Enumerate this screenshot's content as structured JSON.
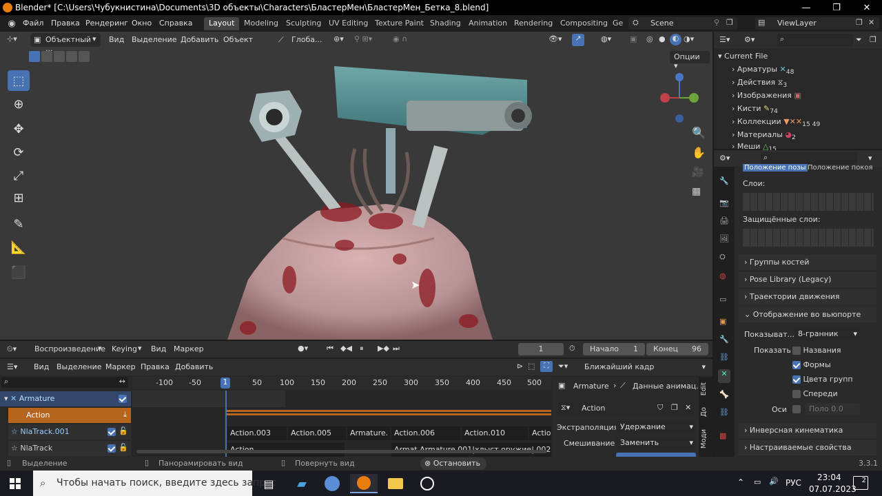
{
  "title": "Blender* [C:\\Users\\Чубукнистина\\Documents\\3D объекты\\Characters\\БластерМен\\БластерМен_Бетка_8.blend]",
  "menu": [
    "Файл",
    "Правка",
    "Рендеринг",
    "Окно",
    "Справка"
  ],
  "workspaces": [
    "Layout",
    "Modeling",
    "Sculpting",
    "UV Editing",
    "Texture Paint",
    "Shading",
    "Animation",
    "Rendering",
    "Compositing",
    "Ge"
  ],
  "scene": "Scene",
  "view_layer": "ViewLayer",
  "viewport": {
    "mode": "Объектный ...",
    "menus": [
      "Вид",
      "Выделение",
      "Добавить",
      "Объект"
    ],
    "transform": "Глоба...",
    "options": "Опции"
  },
  "outliner": {
    "root": "Current File",
    "items": [
      {
        "label": "Арматуры",
        "count": "48"
      },
      {
        "label": "Действия",
        "count": "3"
      },
      {
        "label": "Изображения",
        "count": ""
      },
      {
        "label": "Кисти",
        "count": "74"
      },
      {
        "label": "Коллекции",
        "count": "15 49"
      },
      {
        "label": "Материалы",
        "count": "2"
      },
      {
        "label": "Меши",
        "count": "15"
      }
    ]
  },
  "properties": {
    "tab1": "Положение позы",
    "tab2": "Положение покоя",
    "layers_label": "Слои:",
    "protected_label": "Защищённые слои:",
    "sections": [
      "Группы костей",
      "Pose Library (Legacy)",
      "Траектории движения",
      "Отображение во вьюпорте"
    ],
    "display_as_label": "Показыват...",
    "display_as_value": "8-гранник",
    "show_label": "Показать",
    "checks": [
      {
        "label": "Названия",
        "on": false
      },
      {
        "label": "Формы",
        "on": true
      },
      {
        "label": "Цвета групп",
        "on": true
      },
      {
        "label": "Спереди",
        "on": false
      }
    ],
    "axes_label": "Оси",
    "axes_field": "Поло",
    "axes_value": "0.0",
    "sections2": [
      "Инверсная кинематика",
      "Настраиваемые свойства"
    ]
  },
  "timeline": {
    "playback": "Воспроизведение",
    "keying": "Keying",
    "view": "Вид",
    "marker": "Маркер",
    "current_frame": "1",
    "start_label": "Начало",
    "start": "1",
    "end_label": "Конец",
    "end": "96"
  },
  "nla": {
    "menus": [
      "Вид",
      "Выделение",
      "Маркер",
      "Правка",
      "Добавить"
    ],
    "snap": "Ближайший кадр",
    "ruler": [
      "-100",
      "-50",
      "1",
      "50",
      "100",
      "150",
      "200",
      "250",
      "300",
      "350",
      "400",
      "450",
      "500"
    ],
    "tracks": [
      {
        "name": "Armature",
        "type": "object"
      },
      {
        "name": "Action",
        "type": "action"
      },
      {
        "name": "NlaTrack.001",
        "type": "track"
      },
      {
        "name": "NlaTrack",
        "type": "track"
      }
    ],
    "strips_row1": [
      "Action.003",
      "Action.005",
      "Armature.",
      "Action.006",
      "Action.010",
      "Actio"
    ],
    "strips_row2": [
      "Action",
      "Armat",
      "Armature.001|хлыст.оружие|.002"
    ],
    "side": {
      "breadcrumb1": "Armature",
      "breadcrumb2": "Данные анимац...",
      "action": "Action",
      "extrap_label": "Экстраполяция",
      "extrap_value": "Удержание",
      "blend_label": "Смешивание",
      "blend_value": "Заменить",
      "tabs": [
        "Edit",
        "До",
        "Моди"
      ]
    }
  },
  "status": {
    "select": "Выделение",
    "pan": "Панорамировать вид",
    "rotate": "Повернуть вид",
    "stop": "Остановить",
    "version": "3.3.1"
  },
  "taskbar": {
    "search": "Чтобы начать поиск, введите здесь запрос",
    "lang": "РУС",
    "time": "23:04",
    "date": "07.07.2023",
    "notif": "2"
  },
  "colors": {
    "accent": "#4772b3",
    "action_track": "#b5651d",
    "active_ws": "#444444"
  }
}
